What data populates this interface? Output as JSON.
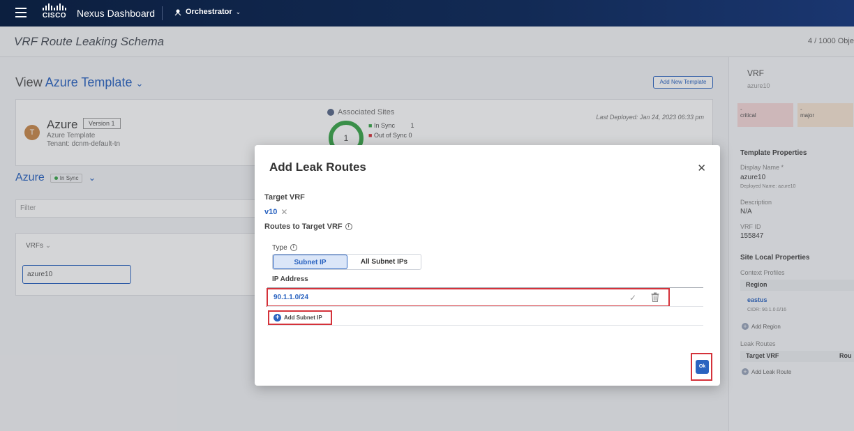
{
  "navbar": {
    "brand_text": "CISCO",
    "app_name": "Nexus Dashboard",
    "module": "Orchestrator"
  },
  "page": {
    "title": "VRF Route Leaking Schema",
    "object_count": "4 / 1000 Obje"
  },
  "view": {
    "prefix": "View",
    "template": "Azure Template",
    "add_new_template": "Add New Template"
  },
  "template_card": {
    "avatar": "T",
    "name": "Azure",
    "version": "Version 1",
    "type": "Azure Template",
    "tenant": "Tenant: dcnm-default-tn",
    "associated_sites": "Associated Sites",
    "ring_count": "1",
    "in_sync_label": "In Sync",
    "in_sync_count": "1",
    "out_sync_label": "Out of Sync",
    "out_sync_count": "0",
    "last_deployed": "Last Deployed: Jan 24, 2023 06:33 pm"
  },
  "site": {
    "name": "Azure",
    "status": "In Sync"
  },
  "filter": {
    "placeholder": "Filter"
  },
  "vrfs": {
    "label": "VRFs",
    "item": "azure10"
  },
  "right_panel": {
    "title": "VRF",
    "subtitle": "azure10",
    "critical_count": "-",
    "critical_label": "critical",
    "major_count": "-",
    "major_label": "major",
    "template_properties": "Template Properties",
    "display_name_label": "Display Name *",
    "display_name": "azure10",
    "deployed_name": "Deployed Name: azure10",
    "description_label": "Description",
    "description": "N/A",
    "vrf_id_label": "VRF ID",
    "vrf_id": "155847",
    "site_local_properties": "Site Local Properties",
    "context_profiles": "Context Profiles",
    "region_header": "Region",
    "region": "eastus",
    "cidr": "CIDR: 90.1.0.0/16",
    "add_region": "Add Region",
    "leak_routes": "Leak Routes",
    "target_vrf_header": "Target VRF",
    "routes_header": "Rou",
    "add_leak_route": "Add Leak Route"
  },
  "modal": {
    "title": "Add Leak Routes",
    "target_vrf_label": "Target VRF",
    "target_vrf_value": "v10",
    "routes_label": "Routes to Target VRF",
    "type_label": "Type",
    "type_options": [
      "Subnet IP",
      "All Subnet IPs"
    ],
    "selected_type": "Subnet IP",
    "ip_address_header": "IP Address",
    "ip_value": "90.1.1.0/24",
    "add_subnet_ip": "Add Subnet IP",
    "ok": "Ok"
  },
  "colors": {
    "accent": "#2a63c0",
    "highlight": "#d4323a",
    "navbar": "#0c1f3f"
  }
}
